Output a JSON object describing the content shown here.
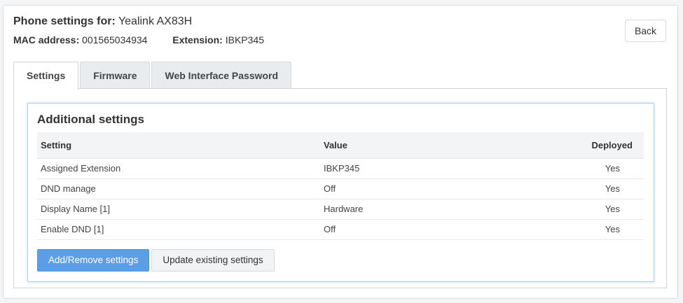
{
  "header": {
    "title_label": "Phone settings for:",
    "title_value": "Yealink AX83H",
    "mac_label": "MAC address:",
    "mac_value": "001565034934",
    "extension_label": "Extension:",
    "extension_value": "IBKP345",
    "back_label": "Back"
  },
  "tabs": [
    {
      "label": "Settings",
      "active": true
    },
    {
      "label": "Firmware",
      "active": false
    },
    {
      "label": "Web Interface Password",
      "active": false
    }
  ],
  "card": {
    "title": "Additional settings",
    "columns": {
      "setting": "Setting",
      "value": "Value",
      "deployed": "Deployed"
    },
    "rows": [
      {
        "setting": "Assigned Extension",
        "value": "IBKP345",
        "deployed": "Yes"
      },
      {
        "setting": "DND manage",
        "value": "Off",
        "deployed": "Yes"
      },
      {
        "setting": "Display Name [1]",
        "value": "Hardware",
        "deployed": "Yes"
      },
      {
        "setting": "Enable DND [1]",
        "value": "Off",
        "deployed": "Yes"
      }
    ],
    "buttons": {
      "add_remove": "Add/Remove settings",
      "update": "Update existing settings"
    }
  },
  "colors": {
    "primary": "#5b9ee6",
    "card_border": "#a9d3ef"
  }
}
